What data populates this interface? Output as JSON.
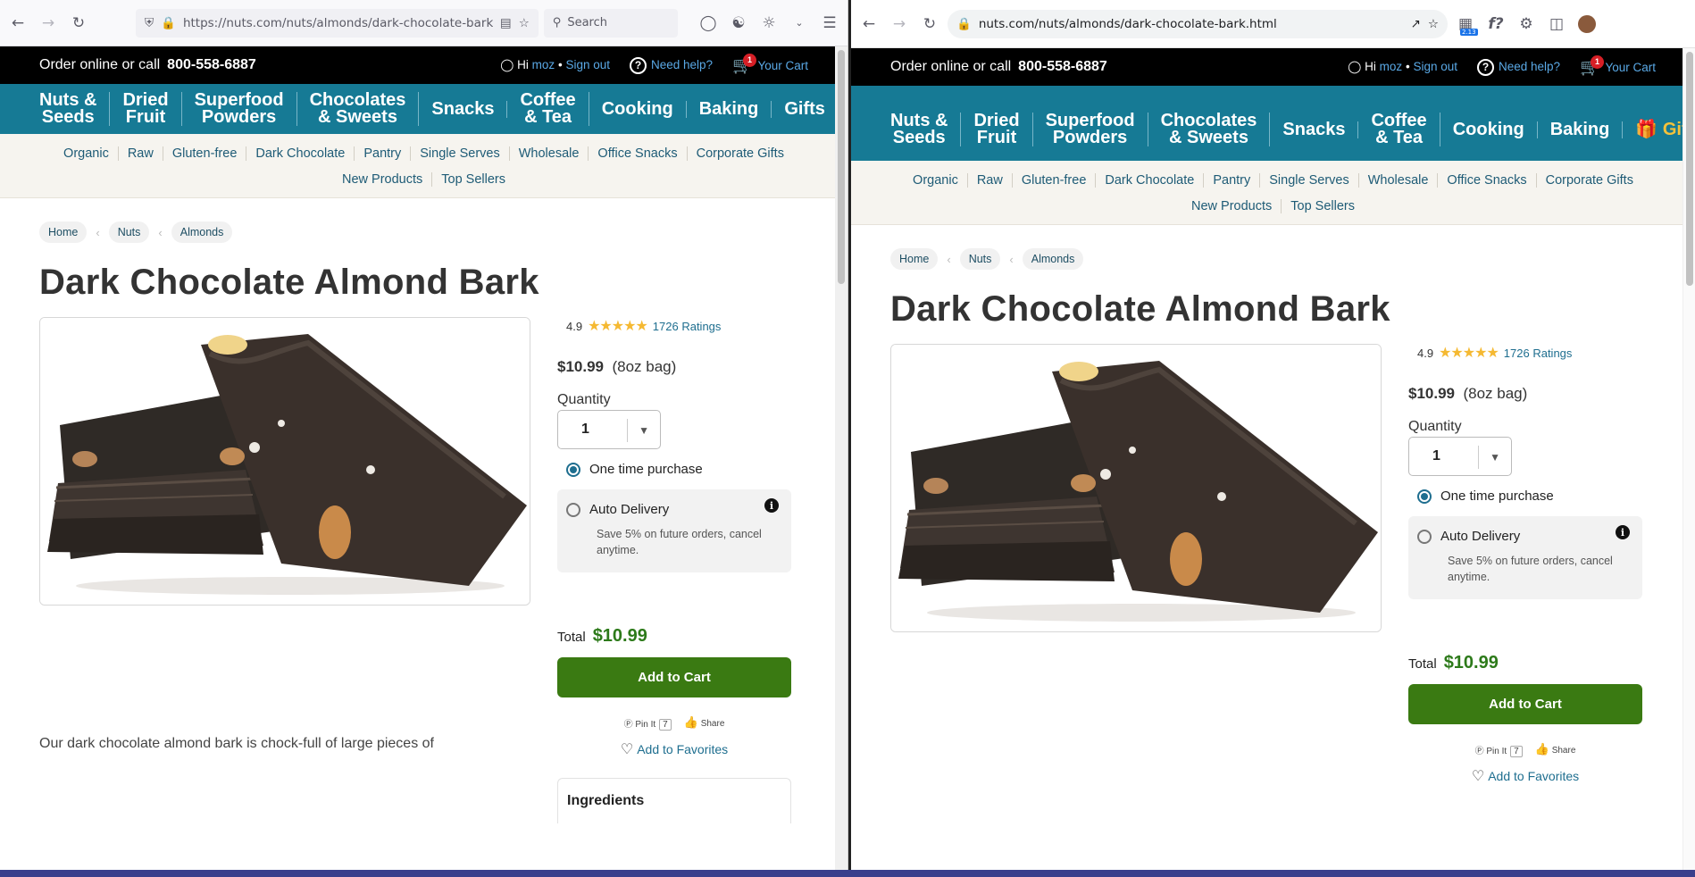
{
  "left_browser": {
    "url": "https://nuts.com/nuts/almonds/dark-chocolate-bark.htm",
    "search_placeholder": "Search"
  },
  "right_browser": {
    "url": "nuts.com/nuts/almonds/dark-chocolate-bark.html",
    "ext_badge": "2.13",
    "ext_label": "f?"
  },
  "site": {
    "order_text": "Order online or call",
    "phone": "800-558-6887",
    "hi": "Hi",
    "user": "moz",
    "bullet": "•",
    "sign_out": "Sign out",
    "help_icon_glyph": "?",
    "need_help": "Need help?",
    "cart_count": "1",
    "your_cart": "Your Cart",
    "categories": [
      {
        "l1": "Nuts &",
        "l2": "Seeds"
      },
      {
        "l1": "Dried",
        "l2": "Fruit"
      },
      {
        "l1": "Superfood",
        "l2": "Powders"
      },
      {
        "l1": "Chocolates",
        "l2": "& Sweets"
      },
      {
        "l1": "Snacks",
        "l2": ""
      },
      {
        "l1": "Coffee",
        "l2": "& Tea"
      },
      {
        "l1": "Cooking",
        "l2": ""
      },
      {
        "l1": "Baking",
        "l2": ""
      },
      {
        "l1": "Gifts",
        "l2": ""
      }
    ],
    "subnav_row1": [
      "Organic",
      "Raw",
      "Gluten-free",
      "Dark Chocolate",
      "Pantry",
      "Single Serves",
      "Wholesale",
      "Office Snacks",
      "Corporate Gifts"
    ],
    "subnav_row2": [
      "New Products",
      "Top Sellers"
    ]
  },
  "product": {
    "crumbs": [
      "Home",
      "Nuts",
      "Almonds"
    ],
    "title": "Dark Chocolate Almond Bark",
    "rating": "4.9",
    "ratings_count": "1726 Ratings",
    "price": "$10.99",
    "size": "(8oz bag)",
    "quantity_label": "Quantity",
    "quantity": "1",
    "one_time": "One time purchase",
    "auto_delivery": "Auto Delivery",
    "auto_desc": "Save 5% on future orders, cancel anytime.",
    "info_glyph": "i",
    "total_label": "Total",
    "total": "$10.99",
    "add_to_cart": "Add to Cart",
    "pin": "Pin It",
    "pin_count": "7",
    "share": "Share",
    "add_fav": "Add to Favorites",
    "ingredients": "Ingredients",
    "description": "Our dark chocolate almond bark is chock-full of large pieces of"
  },
  "colors": {
    "brand_teal": "#167a95",
    "buy_green": "#3a7a12",
    "price_green": "#2d7a1a",
    "star": "#f5b932"
  }
}
